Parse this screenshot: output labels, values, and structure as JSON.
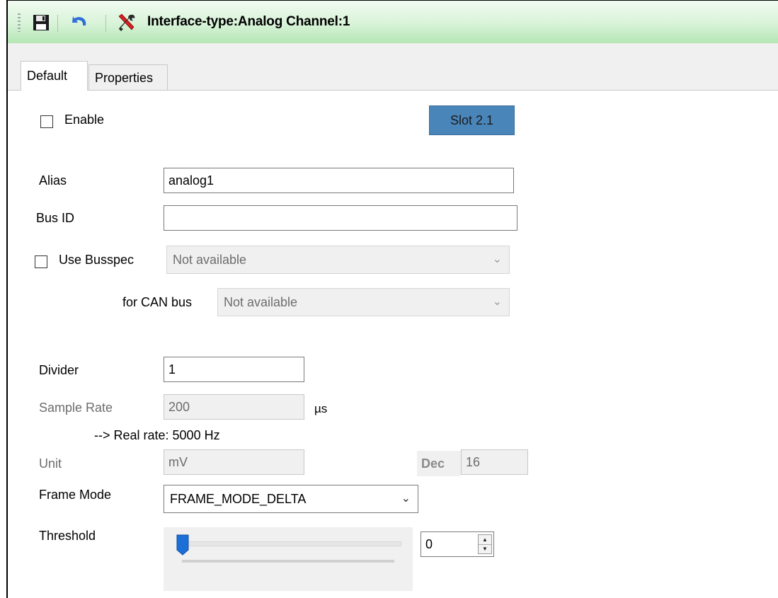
{
  "window": {
    "title": "Interface-type:Analog Channel:1",
    "accent_color": "#b4e6b4"
  },
  "toolbar": {
    "icons": [
      "save-icon",
      "undo-icon",
      "tools-icon"
    ]
  },
  "tabs": [
    {
      "label": "Default",
      "active": true
    },
    {
      "label": "Properties",
      "active": false
    }
  ],
  "form": {
    "enable": {
      "label": "Enable",
      "checked": false
    },
    "slot_button": {
      "label": "Slot 2.1",
      "color": "#4a85ba"
    },
    "alias": {
      "label": "Alias",
      "value": "analog1"
    },
    "bus_id": {
      "label": "Bus ID",
      "value": ""
    },
    "use_busspec": {
      "label": "Use Busspec",
      "checked": false,
      "value": "Not available"
    },
    "can_bus": {
      "label": "for CAN bus",
      "value": "Not available"
    },
    "divider": {
      "label": "Divider",
      "value": "1"
    },
    "sample_rate": {
      "label": "Sample Rate",
      "value": "200",
      "unit": "µs"
    },
    "real_rate": "--> Real rate: 5000 Hz",
    "unit": {
      "label": "Unit",
      "value": "mV"
    },
    "dec": {
      "label": "Dec",
      "value": "16"
    },
    "frame_mode": {
      "label": "Frame Mode",
      "value": "FRAME_MODE_DELTA"
    },
    "threshold": {
      "label": "Threshold",
      "value": "0",
      "slider_level": 0
    }
  }
}
